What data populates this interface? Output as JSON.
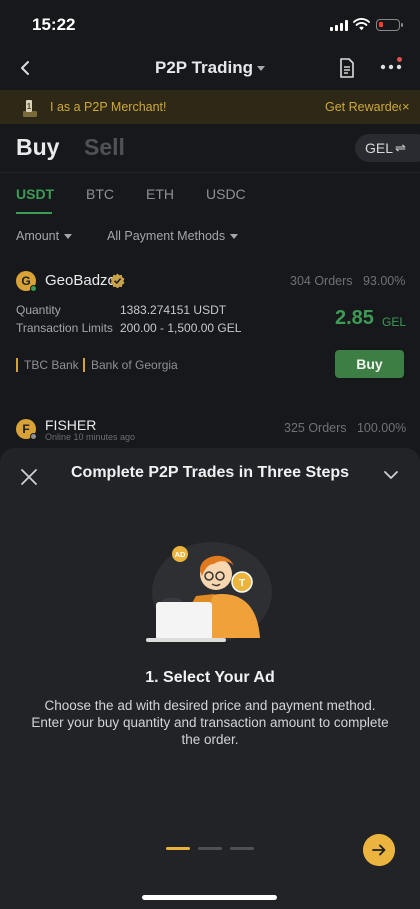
{
  "status_bar": {
    "time": "15:22"
  },
  "nav": {
    "title": "P2P Trading"
  },
  "banner": {
    "text": "I as a P2P Merchant!",
    "cta": "Get Rewardec",
    "close": "×"
  },
  "trade_tabs": {
    "buy": "Buy",
    "sell": "Sell",
    "fiat": "GEL",
    "swap": "⇌"
  },
  "coins": [
    "USDT",
    "BTC",
    "ETH",
    "USDC"
  ],
  "active_coin": "USDT",
  "filters": {
    "amount": "Amount",
    "payment": "All Payment Methods"
  },
  "listings": [
    {
      "initial": "G",
      "name": "GeoBadzo",
      "orders": "304 Orders",
      "completion": "93.00%",
      "quantity_label": "Quantity",
      "quantity": "1383.274151 USDT",
      "limits_label": "Transaction Limits",
      "limits": "200.00 - 1,500.00 GEL",
      "price": "2.85",
      "price_unit": "GEL",
      "payments": [
        "TBC Bank",
        "Bank of Georgia"
      ],
      "action": "Buy",
      "online_color": "#3d9b55"
    },
    {
      "initial": "F",
      "name": "FISHER",
      "status": "Online 10 minutes ago",
      "orders": "325 Orders",
      "completion": "100.00%",
      "online_color": "#8e9096"
    }
  ],
  "sheet": {
    "title": "Complete P2P Trades in Three Steps",
    "step_title": "1. Select Your Ad",
    "step_desc": "Choose the ad with desired price and payment method. Enter your buy quantity and transaction amount to complete the order.",
    "illustration_badges": {
      "ad": "AD",
      "token": "T"
    },
    "pages": 3,
    "current_page": 1
  },
  "colors": {
    "accent_green": "#3d9b55",
    "accent_gold": "#ebb43e",
    "background": "#17181b",
    "sheet": "#222327"
  }
}
